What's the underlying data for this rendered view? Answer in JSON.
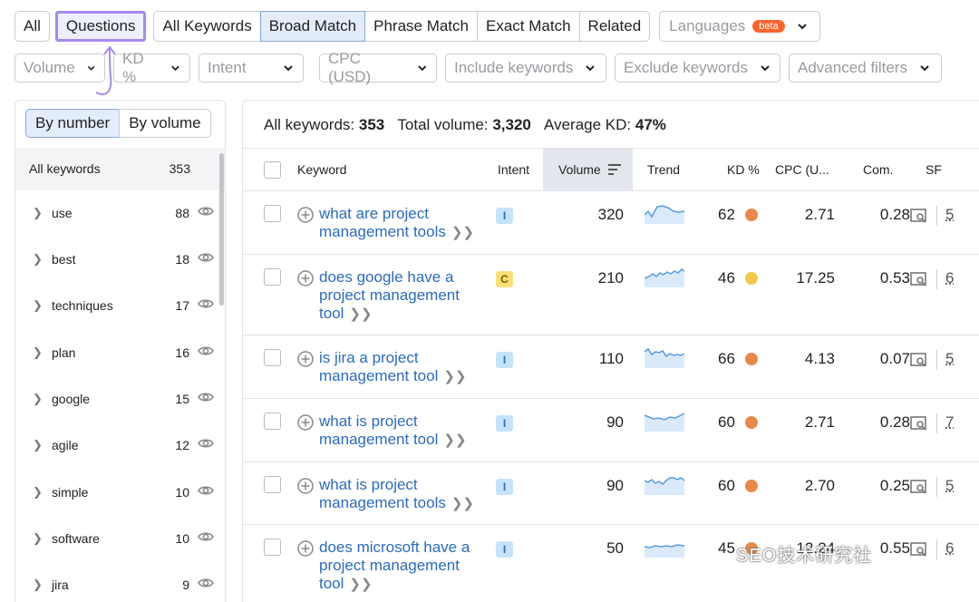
{
  "tabs": {
    "all": "All",
    "questions": "Questions",
    "match": [
      "All Keywords",
      "Broad Match",
      "Phrase Match",
      "Exact Match",
      "Related"
    ],
    "languages": "Languages",
    "beta": "beta"
  },
  "filters": [
    "Volume",
    "KD %",
    "Intent",
    "CPC (USD)",
    "Include keywords",
    "Exclude keywords",
    "Advanced filters"
  ],
  "sidebar": {
    "seg_number": "By number",
    "seg_volume": "By volume",
    "all_label": "All keywords",
    "all_count": "353",
    "items": [
      {
        "label": "use",
        "count": "88"
      },
      {
        "label": "best",
        "count": "18"
      },
      {
        "label": "techniques",
        "count": "17"
      },
      {
        "label": "plan",
        "count": "16"
      },
      {
        "label": "google",
        "count": "15"
      },
      {
        "label": "agile",
        "count": "12"
      },
      {
        "label": "simple",
        "count": "10"
      },
      {
        "label": "software",
        "count": "10"
      },
      {
        "label": "jira",
        "count": "9"
      }
    ]
  },
  "summary": {
    "all_label": "All keywords:",
    "all_value": "353",
    "total_label": "Total volume:",
    "total_value": "3,320",
    "kd_label": "Average KD:",
    "kd_value": "47%"
  },
  "table": {
    "headers": {
      "keyword": "Keyword",
      "intent": "Intent",
      "volume": "Volume",
      "trend": "Trend",
      "kd": "KD %",
      "cpc": "CPC (U...",
      "com": "Com.",
      "sf": "SF"
    },
    "rows": [
      {
        "keyword": "what are project management tools",
        "intent": "I",
        "volume": "320",
        "kd": "62",
        "kd_color": "#e8894a",
        "cpc": "2.71",
        "com": "0.28",
        "sf": "5"
      },
      {
        "keyword": "does google have a project management tool",
        "intent": "C",
        "volume": "210",
        "kd": "46",
        "kd_color": "#f2c94c",
        "cpc": "17.25",
        "com": "0.53",
        "sf": "6"
      },
      {
        "keyword": "is jira a project management tool",
        "intent": "I",
        "volume": "110",
        "kd": "66",
        "kd_color": "#e8894a",
        "cpc": "4.13",
        "com": "0.07",
        "sf": "5"
      },
      {
        "keyword": "what is project management tool",
        "intent": "I",
        "volume": "90",
        "kd": "60",
        "kd_color": "#e8894a",
        "cpc": "2.71",
        "com": "0.28",
        "sf": "7"
      },
      {
        "keyword": "what is project management tools",
        "intent": "I",
        "volume": "90",
        "kd": "60",
        "kd_color": "#e8894a",
        "cpc": "2.70",
        "com": "0.25",
        "sf": "5"
      },
      {
        "keyword": "does microsoft have a project management tool",
        "intent": "I",
        "volume": "50",
        "kd": "45",
        "kd_color": "#e8894a",
        "cpc": "12.24",
        "com": "0.55",
        "sf": "6"
      }
    ]
  },
  "watermark": "SEO技术研究社"
}
